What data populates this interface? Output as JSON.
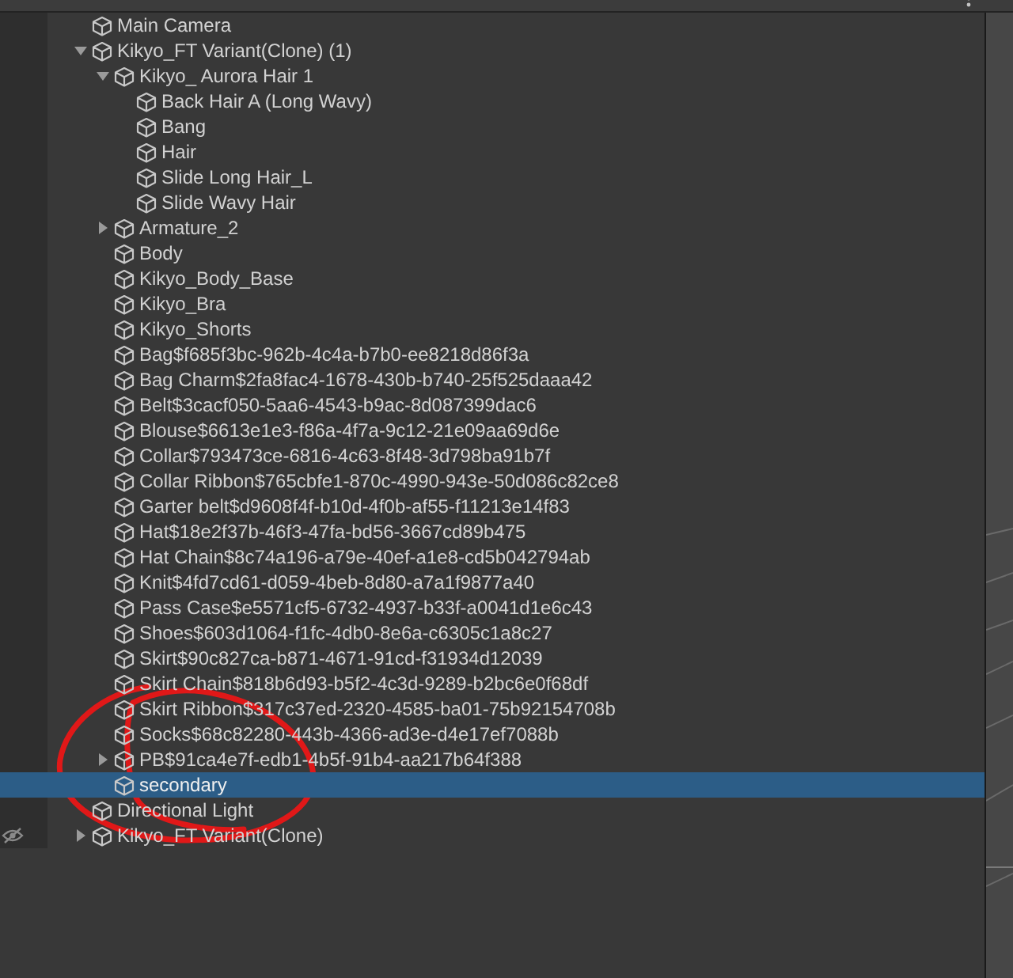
{
  "hierarchy": {
    "items": [
      {
        "name": "Main Camera",
        "selected": false
      },
      {
        "name": "Kikyo_FT Variant(Clone) (1)",
        "selected": false,
        "expanded": true,
        "children": [
          {
            "name": "Kikyo_ Aurora Hair 1",
            "selected": false,
            "expanded": true,
            "children": [
              {
                "name": "Back Hair A (Long Wavy)",
                "selected": false
              },
              {
                "name": "Bang",
                "selected": false
              },
              {
                "name": "Hair",
                "selected": false
              },
              {
                "name": "Slide Long Hair_L",
                "selected": false
              },
              {
                "name": "Slide Wavy Hair",
                "selected": false
              }
            ]
          },
          {
            "name": "Armature_2",
            "selected": false,
            "expanded": false
          },
          {
            "name": "Body",
            "selected": false
          },
          {
            "name": "Kikyo_Body_Base",
            "selected": false
          },
          {
            "name": "Kikyo_Bra",
            "selected": false
          },
          {
            "name": "Kikyo_Shorts",
            "selected": false
          },
          {
            "name": "Bag$f685f3bc-962b-4c4a-b7b0-ee8218d86f3a",
            "selected": false
          },
          {
            "name": "Bag Charm$2fa8fac4-1678-430b-b740-25f525daaa42",
            "selected": false
          },
          {
            "name": "Belt$3cacf050-5aa6-4543-b9ac-8d087399dac6",
            "selected": false
          },
          {
            "name": "Blouse$6613e1e3-f86a-4f7a-9c12-21e09aa69d6e",
            "selected": false
          },
          {
            "name": "Collar$793473ce-6816-4c63-8f48-3d798ba91b7f",
            "selected": false
          },
          {
            "name": "Collar Ribbon$765cbfe1-870c-4990-943e-50d086c82ce8",
            "selected": false
          },
          {
            "name": "Garter belt$d9608f4f-b10d-4f0b-af55-f11213e14f83",
            "selected": false
          },
          {
            "name": "Hat$18e2f37b-46f3-47fa-bd56-3667cd89b475",
            "selected": false
          },
          {
            "name": "Hat Chain$8c74a196-a79e-40ef-a1e8-cd5b042794ab",
            "selected": false
          },
          {
            "name": "Knit$4fd7cd61-d059-4beb-8d80-a7a1f9877a40",
            "selected": false
          },
          {
            "name": "Pass Case$e5571cf5-6732-4937-b33f-a0041d1e6c43",
            "selected": false
          },
          {
            "name": "Shoes$603d1064-f1fc-4db0-8e6a-c6305c1a8c27",
            "selected": false
          },
          {
            "name": "Skirt$90c827ca-b871-4671-91cd-f31934d12039",
            "selected": false
          },
          {
            "name": "Skirt Chain$818b6d93-b5f2-4c3d-9289-b2bc6e0f68df",
            "selected": false
          },
          {
            "name": "Skirt Ribbon$317c37ed-2320-4585-ba01-75b92154708b",
            "selected": false
          },
          {
            "name": "Socks$68c82280-443b-4366-ad3e-d4e17ef7088b",
            "selected": false
          },
          {
            "name": "PB$91ca4e7f-edb1-4b5f-91b4-aa217b64f388",
            "selected": false,
            "expanded": false
          },
          {
            "name": "secondary",
            "selected": true
          }
        ]
      },
      {
        "name": "Directional Light",
        "selected": false
      },
      {
        "name": "Kikyo_FT Variant(Clone)",
        "selected": false,
        "expanded": false,
        "hidden": true
      }
    ]
  }
}
